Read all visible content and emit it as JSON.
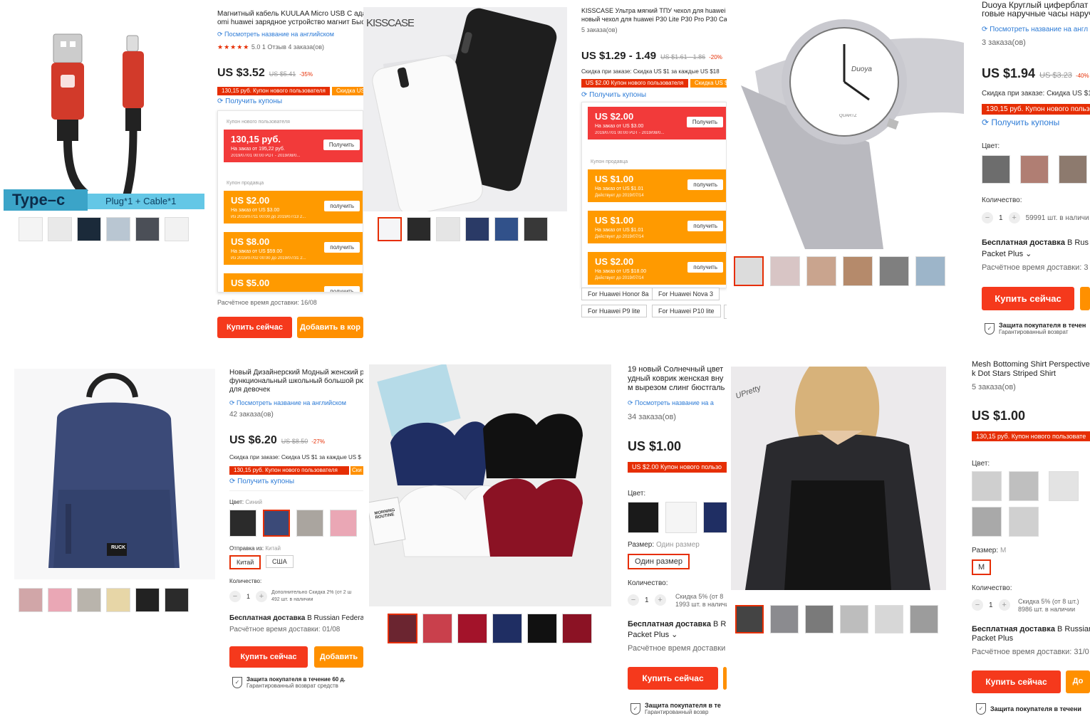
{
  "p1": {
    "banner_left": "Type–c",
    "banner_right": "Plug*1 + Cable*1",
    "title": "Магнитный кабель KUULAA Micro USB C адаптер",
    "title2": "omi huawei зарядное устройство магнит Быстрая",
    "translate": "Посмотреть название на английском",
    "rating_stars": "★★★★★",
    "rating": "5.0",
    "reviews": "1 Отзыв  4 заказа(ов)",
    "price": "US $3.52",
    "old_price": "US $5.41",
    "discount": "-35%",
    "coupon_bar": "130,15 руб. Купон нового пользователя",
    "coupon_bar2": "Скидка US $",
    "get_coupons": "Получить купоны",
    "new_user_label": "Купон нового пользователя",
    "nu_value": "130,15 руб.",
    "nu_order": "На заказ от  195,22 руб.",
    "nu_dates": "2019/07/01 00:00 PDT - 2019/08/0...",
    "get": "Получить",
    "seller_label": "Купон продавца",
    "c1_value": "US $2.00",
    "c1_order": "На заказ от  US $3.00",
    "c1_dates": "Из 2019/07/11 00:00 до 2019/07/13 2...",
    "c2_value": "US $8.00",
    "c2_order": "На заказ от  US $59.00",
    "c2_dates": "Из 2019/07/02 00:00 до 2019/07/31 2...",
    "c3_value": "US $5.00",
    "get_lower": "получить",
    "delivery_time": "Расчётное время доставки: 16/08",
    "buy": "Купить сейчас",
    "add": "Добавить в кор"
  },
  "p2": {
    "brand": "KISSCASE",
    "title": "KISSCASE Ультра мягкий ТПУ чехол для huawei",
    "title2": "новый чехол для huawei P30 Lite P30 Pro P30 Ca",
    "orders": "5 заказа(ов)",
    "price": "US $1.29 - 1.49",
    "old_price": "US $1.61 - 1.86",
    "discount": "-20%",
    "order_discount": "Скидка при заказе: Скидка US $1 за каждые US $18",
    "coupon_bar": "US $2.00 Купон нового пользователя",
    "coupon_bar2": "Скидка US $",
    "get_coupons": "Получить купоны",
    "nu_value": "US $2.00",
    "nu_order": "На заказ от  US $3.00",
    "nu_dates": "2019/07/01 00:00 PDT - 2019/08/0...",
    "get": "Получить",
    "seller_label": "Купон продавца",
    "c1_value": "US $1.00",
    "c1_order": "На заказ от  US $1.01",
    "c1_dates": "Действует до 2019/07/14",
    "c2_value": "US $1.00",
    "c2_order": "На заказ от  US $1.01",
    "c2_dates": "Действует до 2019/07/14",
    "c3_value": "US $2.00",
    "c3_order": "На заказ от  US $18.00",
    "c3_dates": "Действует до 2019/07/14",
    "get_lower": "получить",
    "model1": "For Huawei Honor 8a",
    "model2": "For Huawei Nova 3",
    "model3": "For Huawei P9 lite",
    "model4": "For Huawei P10 lite"
  },
  "p3": {
    "face_brand": "Duoya",
    "face_text": "QUARTZ",
    "title": "Duoya Круглый циферблат к",
    "title2": "говые наручные часы наруч",
    "translate": "Посмотреть название на англ",
    "orders": "3 заказа(ов)",
    "price": "US $1.94",
    "old_price": "US $3.23",
    "discount": "-40%",
    "order_discount": "Скидка при заказе: Скидка US $1 з",
    "coupon_bar": "130,15 руб. Купон нового пользо",
    "get_coupons": "Получить купоны",
    "color_label": "Цвет:",
    "qty_label": "Количество:",
    "qty": "1",
    "stock": "59991 шт. в наличи",
    "shipping": "Бесплатная доставка",
    "shipping_to": "В Rus",
    "packet": "Packet Plus ⌄",
    "delivery_time": "Расчётное время доставки: 3",
    "buy": "Купить сейчас",
    "protect": "Защита покупателя в течен",
    "refund": "Гарантированный возврат"
  },
  "p4": {
    "logo": "RUCK",
    "title": "Новый Дизайнерский Модный женский р",
    "title2": "функциональный школьный большой рю",
    "title3": "для девочек",
    "translate": "Посмотреть название на английском",
    "orders": "42 заказа(ов)",
    "price": "US $6.20",
    "old_price": "US $8.50",
    "discount": "-27%",
    "order_discount": "Скидка при заказе: Скидка US $1 за каждые US $",
    "coupon_bar": "130,15 руб. Купон нового пользователя",
    "coupon_bar2": "Ски",
    "get_coupons": "Получить купоны",
    "color_label": "Цвет:",
    "color_value": "Синий",
    "ship_from": "Отправка из:",
    "ship_from_value": "Китай",
    "opt_china": "Китай",
    "opt_usa": "США",
    "qty_label": "Количество:",
    "qty": "1",
    "extra": "Дополнительно Скидка 2% (от 2 ш",
    "stock": "492 шт. в наличии",
    "shipping": "Бесплатная доставка",
    "shipping_to": "В Russian Federati",
    "delivery_time": "Расчётное время доставки: 01/08",
    "buy": "Купить сейчас",
    "add": "Добавить",
    "protect": "Защита покупателя в течение 60 д.",
    "refund": "Гарантированный возврат средств"
  },
  "p5": {
    "card_text": "MORNING ROUTINE",
    "title": "19 новый Солнечный цвет",
    "title2": "удный коврик женская вну",
    "title3": "м вырезом слинг бюстгаль",
    "translate": "Посмотреть название на а",
    "orders": "34 заказа(ов)",
    "price": "US $1.00",
    "coupon_bar": "US $2.00 Купон нового пользо",
    "color_label": "Цвет:",
    "size_label": "Размер:",
    "size_value": "Один размер",
    "size_opt": "Один размер",
    "qty_label": "Количество:",
    "qty": "1",
    "extra": "Скидка 5% (от 8",
    "stock": "1993 шт. в наличи",
    "shipping": "Бесплатная доставка",
    "shipping_to": "В Ru",
    "packet": "Packet Plus ⌄",
    "delivery_time": "Расчётное время доставки",
    "buy": "Купить сейчас",
    "protect": "Защита покупателя в те",
    "refund": "Гарантированный возвр"
  },
  "p6": {
    "brand": "UPretty",
    "title": "Mesh Bottoming Shirt Perspective",
    "title2": "k Dot Stars Striped Shirt",
    "orders": "5 заказа(ов)",
    "price": "US $1.00",
    "coupon_bar": "130,15 руб. Купон нового пользовате",
    "color_label": "Цвет:",
    "size_label": "Размер:",
    "size_value": "M",
    "size_opt": "M",
    "qty_label": "Количество:",
    "qty": "1",
    "extra": "Скидка 5% (от 8 шт.)",
    "stock": "8986 шт. в наличии",
    "shipping": "Бесплатная доставка",
    "shipping_to": "В Russian",
    "packet": "Packet Plus",
    "delivery_time": "Расчётное время доставки: 31/0",
    "buy": "Купить сейчас",
    "add": "До",
    "protect": "Защита покупателя в течени"
  }
}
